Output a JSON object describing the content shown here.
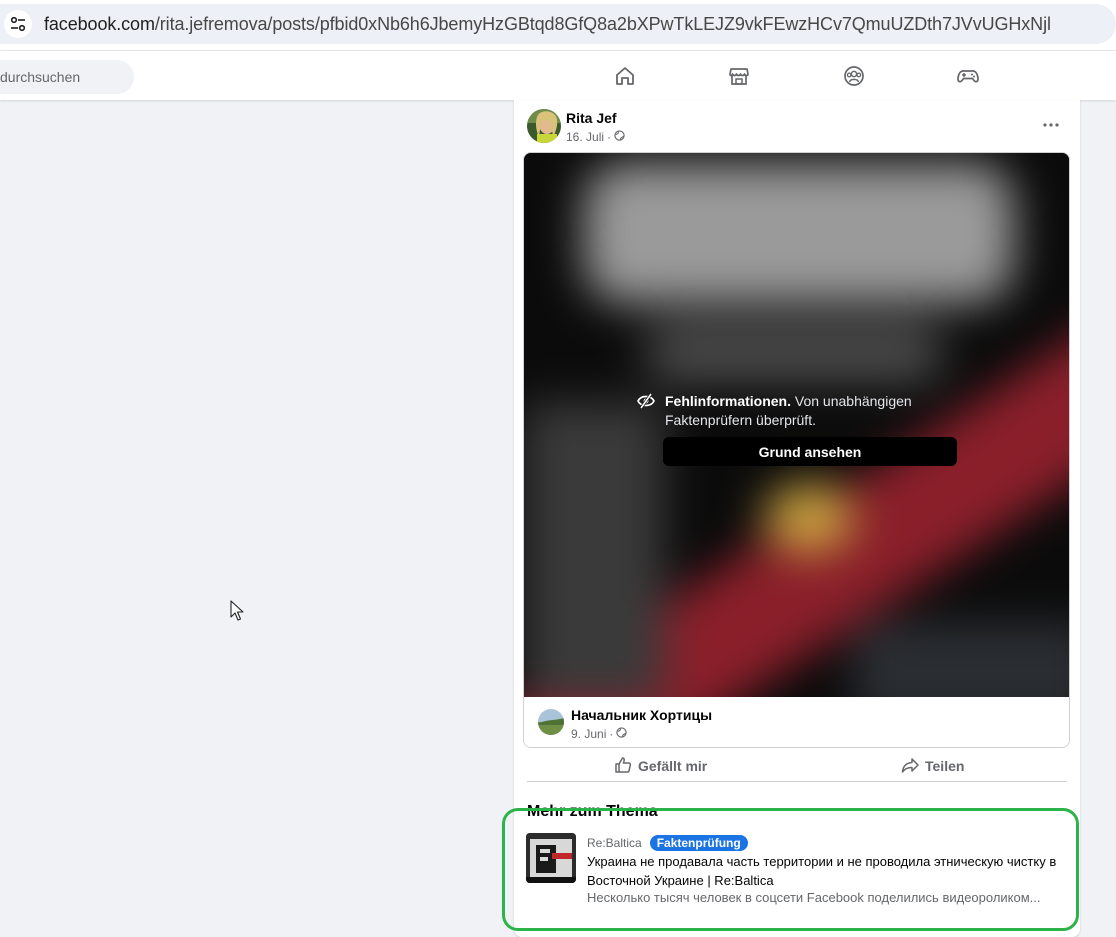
{
  "browser": {
    "url_host": "facebook.com",
    "url_path": "/rita.jefremova/posts/pfbid0xNb6h6JbemyHzGBtqd8GfQ8a2bXPwTkLEJZ9vkFEwzHCv7QmuUZDth7JVvUGHxNjl",
    "site_info_icon": "tune-icon"
  },
  "nav": {
    "search_placeholder": "durchsuchen",
    "icons": [
      "home-icon",
      "marketplace-icon",
      "groups-icon",
      "gaming-icon"
    ]
  },
  "post": {
    "author": "Rita Jef",
    "date": "16. Juli",
    "separator": "·",
    "audience_icon": "globe-icon",
    "more_icon": "more-options-icon",
    "warning": {
      "title": "Fehlinformationen.",
      "text": "Von unabhängigen Faktenprüfern überprüft.",
      "button": "Grund ansehen"
    },
    "shared": {
      "author": "Начальник Хортицы",
      "date": "9. Juni",
      "separator": "·"
    },
    "actions": {
      "like": "Gefällt mir",
      "share": "Teilen"
    }
  },
  "related": {
    "heading": "Mehr zum Thema",
    "source": "Re:Baltica",
    "badge": "Faktenprüfung",
    "title": "Украина не продавала часть территории и не проводила этническую чистку в Восточной Украине | Re:Baltica",
    "description": "Несколько тысяч человек в соцсети Facebook поделились видеороликом..."
  },
  "colors": {
    "accent": "#1b74e4",
    "highlight": "#2cb34a",
    "page_bg": "#f0f2f5"
  }
}
